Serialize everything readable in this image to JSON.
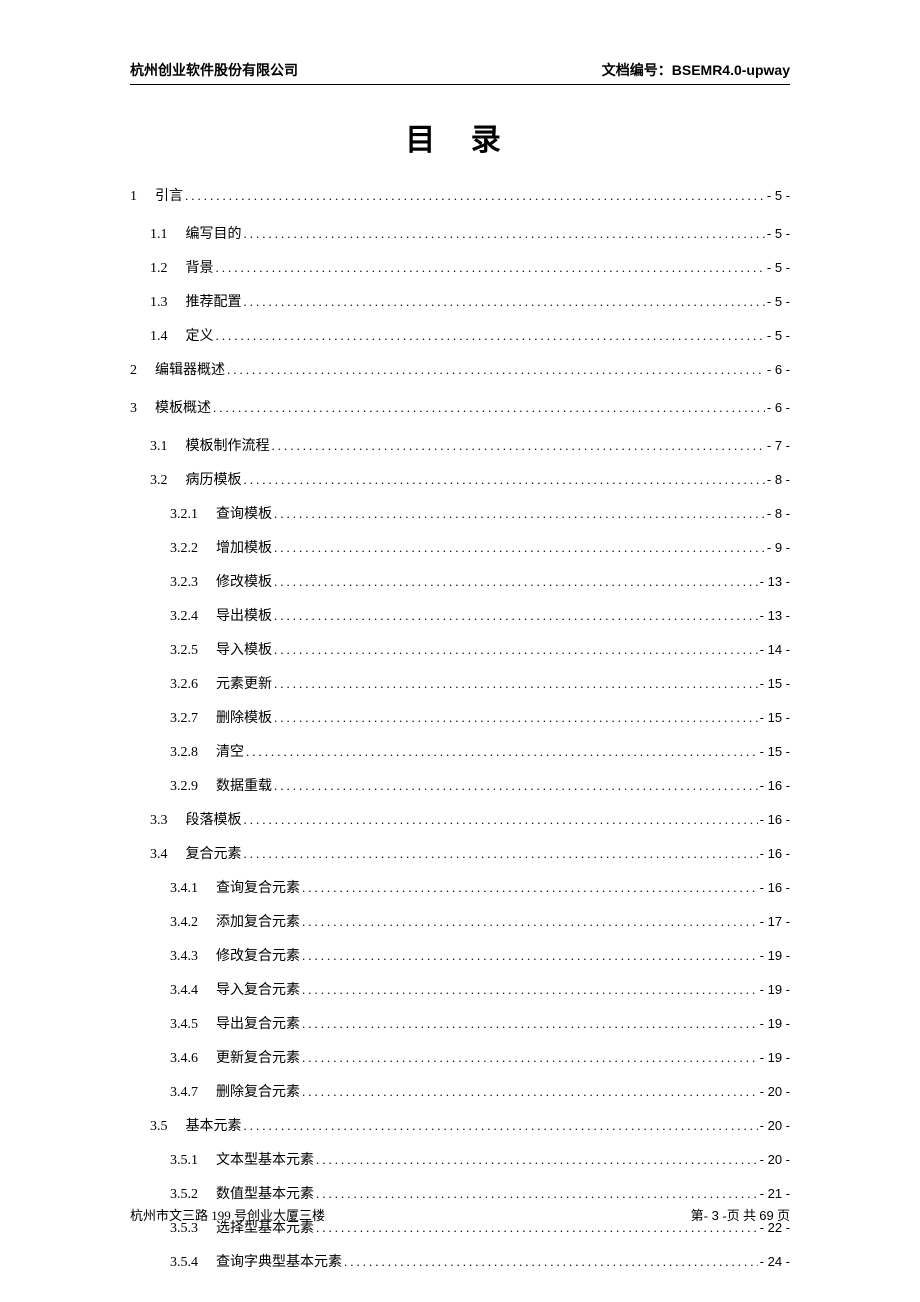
{
  "header": {
    "company": "杭州创业软件股份有限公司",
    "doc_label": "文档编号：",
    "doc_number": "BSEMR4.0-upway"
  },
  "title": "目  录",
  "toc": [
    {
      "level": 1,
      "num": "1",
      "label": "引言",
      "page": "- 5 -"
    },
    {
      "level": 2,
      "num": "1.1",
      "label": "编写目的",
      "page": "- 5 -"
    },
    {
      "level": 2,
      "num": "1.2",
      "label": "背景",
      "page": "- 5 -"
    },
    {
      "level": 2,
      "num": "1.3",
      "label": "推荐配置",
      "page": "- 5 -"
    },
    {
      "level": 2,
      "num": "1.4",
      "label": "定义",
      "page": "- 5 -"
    },
    {
      "level": 1,
      "num": "2",
      "label": "编辑器概述",
      "page": "- 6 -"
    },
    {
      "level": 1,
      "num": "3",
      "label": "模板概述",
      "page": "- 6 -"
    },
    {
      "level": 2,
      "num": "3.1",
      "label": "模板制作流程",
      "page": "- 7 -"
    },
    {
      "level": 2,
      "num": "3.2",
      "label": "病历模板",
      "page": "- 8 -"
    },
    {
      "level": 3,
      "num": "3.2.1",
      "label": "查询模板",
      "page": "- 8 -"
    },
    {
      "level": 3,
      "num": "3.2.2",
      "label": "增加模板",
      "page": "- 9 -"
    },
    {
      "level": 3,
      "num": "3.2.3",
      "label": "修改模板",
      "page": "- 13 -"
    },
    {
      "level": 3,
      "num": "3.2.4",
      "label": "导出模板",
      "page": "- 13 -"
    },
    {
      "level": 3,
      "num": "3.2.5",
      "label": "导入模板",
      "page": "- 14 -"
    },
    {
      "level": 3,
      "num": "3.2.6",
      "label": "元素更新",
      "page": "- 15 -"
    },
    {
      "level": 3,
      "num": "3.2.7",
      "label": "删除模板",
      "page": "- 15 -"
    },
    {
      "level": 3,
      "num": "3.2.8",
      "label": "清空",
      "page": "- 15 -"
    },
    {
      "level": 3,
      "num": "3.2.9",
      "label": "数据重载",
      "page": "- 16 -"
    },
    {
      "level": 2,
      "num": "3.3",
      "label": "段落模板",
      "page": "- 16 -"
    },
    {
      "level": 2,
      "num": "3.4",
      "label": "复合元素",
      "page": "- 16 -"
    },
    {
      "level": 3,
      "num": "3.4.1",
      "label": "查询复合元素",
      "page": "- 16 -"
    },
    {
      "level": 3,
      "num": "3.4.2",
      "label": "添加复合元素",
      "page": "- 17 -"
    },
    {
      "level": 3,
      "num": "3.4.3",
      "label": "修改复合元素",
      "page": "- 19 -"
    },
    {
      "level": 3,
      "num": "3.4.4",
      "label": "导入复合元素",
      "page": "- 19 -"
    },
    {
      "level": 3,
      "num": "3.4.5",
      "label": "导出复合元素",
      "page": "- 19 -"
    },
    {
      "level": 3,
      "num": "3.4.6",
      "label": "更新复合元素",
      "page": "- 19 -"
    },
    {
      "level": 3,
      "num": "3.4.7",
      "label": "删除复合元素",
      "page": "- 20 -"
    },
    {
      "level": 2,
      "num": "3.5",
      "label": "基本元素",
      "page": "- 20 -"
    },
    {
      "level": 3,
      "num": "3.5.1",
      "label": "文本型基本元素",
      "page": "- 20 -"
    },
    {
      "level": 3,
      "num": "3.5.2",
      "label": "数值型基本元素",
      "page": "- 21 -"
    },
    {
      "level": 3,
      "num": "3.5.3",
      "label": "选择型基本元素",
      "page": "- 22 -"
    },
    {
      "level": 3,
      "num": "3.5.4",
      "label": "查询字典型基本元素",
      "page": "- 24 -"
    }
  ],
  "footer": {
    "address": "杭州市文三路 199 号创业大厦三楼",
    "page_prefix": "第-",
    "page_curr": " 3 ",
    "page_mid": "-页 共 ",
    "page_total": "69",
    "page_suffix": " 页"
  }
}
